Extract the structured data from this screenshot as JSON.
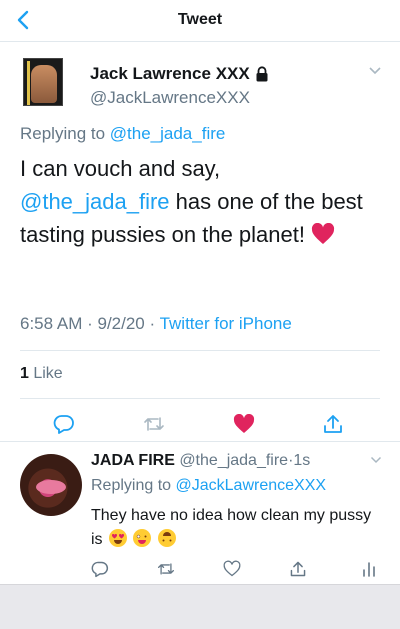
{
  "nav": {
    "title": "Tweet"
  },
  "tweet": {
    "display_name": "Jack Lawrence XXX",
    "handle": "@JackLawrenceXXX",
    "replying_prefix": "Replying to ",
    "replying_handle": "@the_jada_fire",
    "text_line1": "I can vouch and say,",
    "text_mention": "@the_jada_fire",
    "text_rest": " has one of the best tasting pussies on the planet!",
    "time": "6:58 AM",
    "date": "9/2/20",
    "source": "Twitter for iPhone",
    "meta_sep": " · ",
    "likes_count": "1",
    "likes_label": " Like"
  },
  "reply": {
    "display_name": "JADA FIRE",
    "handle": "@the_jada_fire",
    "time": "1s",
    "time_sep": "·",
    "replying_prefix": "Replying to ",
    "replying_handle": "@JackLawrenceXXX",
    "text": "They have no idea how clean my pussy is"
  },
  "icons": {
    "back": "chevron-left-icon",
    "lock": "lock-icon",
    "more": "chevron-down-icon",
    "reply": "reply-icon",
    "retweet": "retweet-icon",
    "like": "heart-icon",
    "share": "share-icon",
    "analytics": "analytics-icon"
  },
  "colors": {
    "accent": "#1da1f2",
    "muted": "#657786",
    "like": "#e0245e"
  }
}
